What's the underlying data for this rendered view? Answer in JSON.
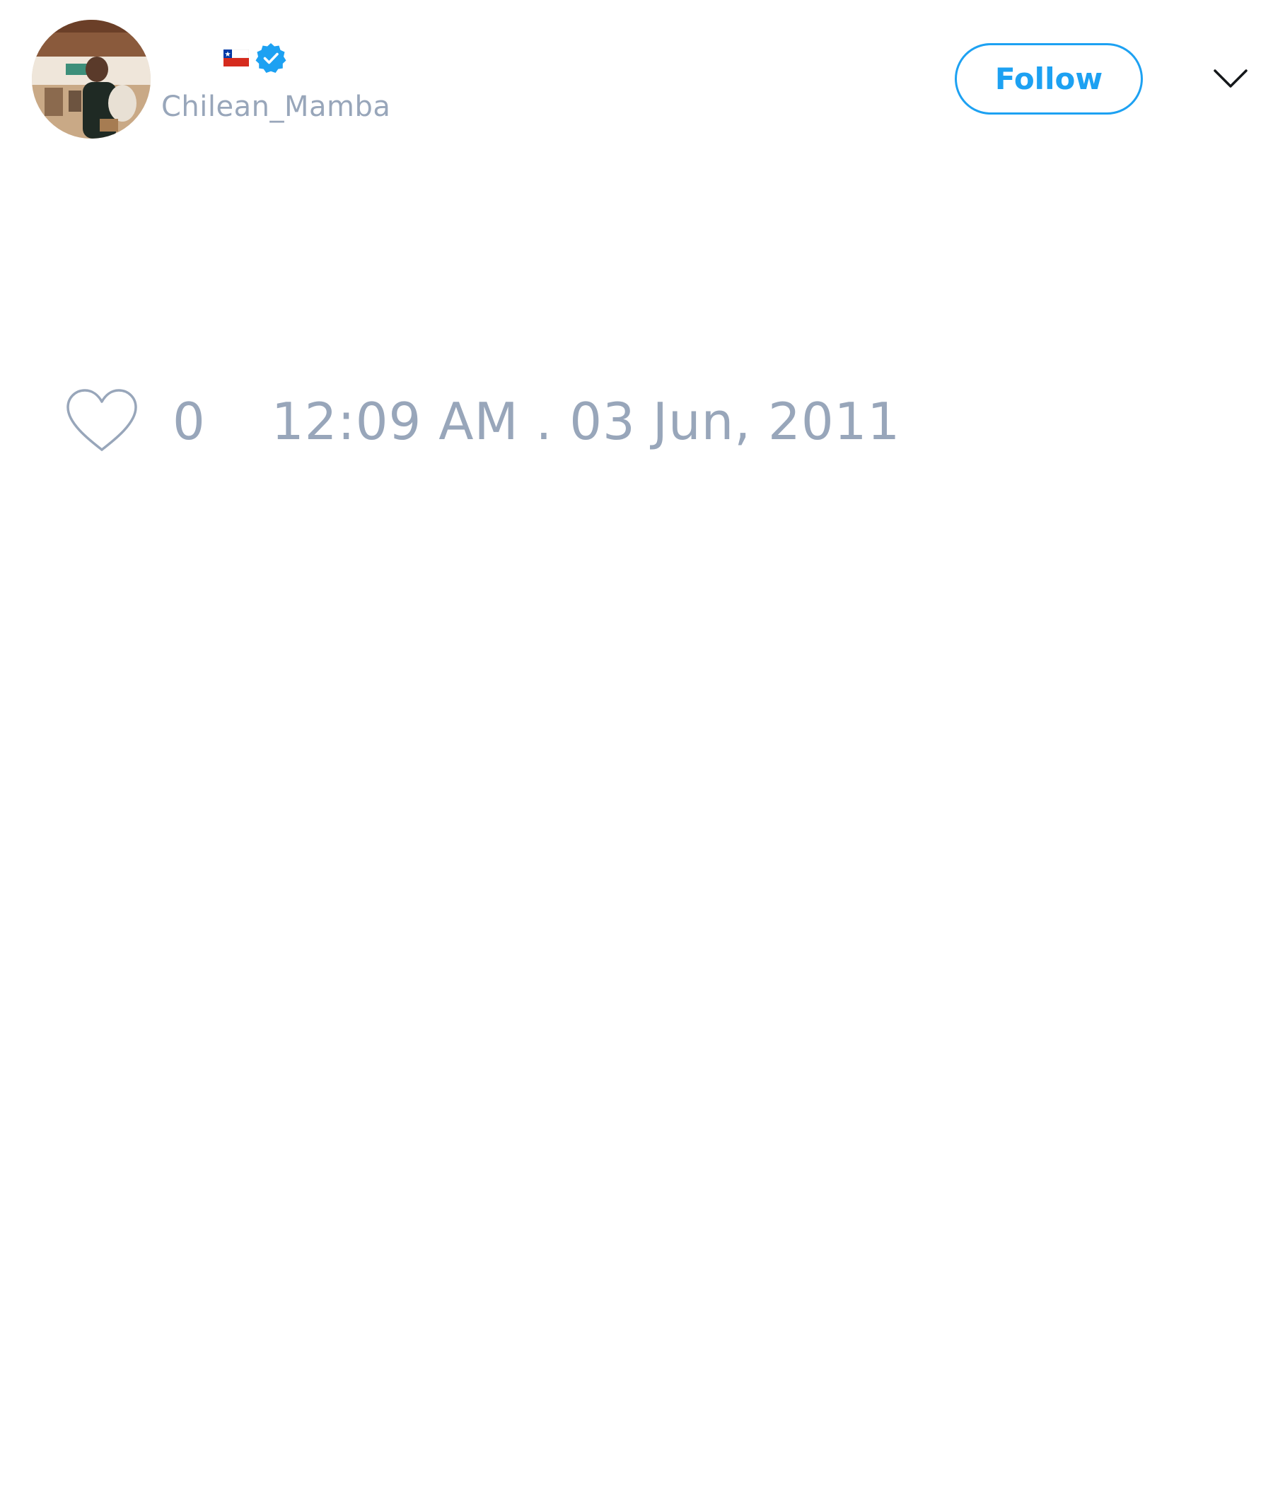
{
  "user": {
    "display_name": "",
    "handle": "Chilean_Mamba",
    "flag": "chile-flag-icon",
    "verified": true
  },
  "header": {
    "follow_label": "Follow",
    "menu_icon": "chevron-down-icon"
  },
  "actions": {
    "like_icon": "heart-icon",
    "like_count": "0",
    "timestamp": "12:09 AM . 03 Jun, 2011"
  },
  "colors": {
    "accent": "#1da1f2",
    "muted_text": "#98a6ba",
    "background": "#ffffff"
  }
}
